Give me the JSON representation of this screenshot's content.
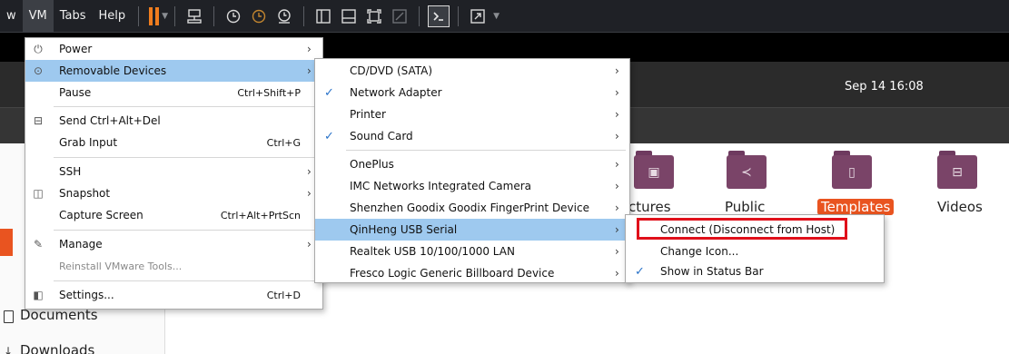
{
  "toolbar": {
    "menus": [
      "w",
      "VM",
      "Tabs",
      "Help"
    ],
    "active_menu": "VM"
  },
  "guest": {
    "clock": "Sep 14 16:08",
    "sidebar": {
      "documents": "Documents",
      "downloads": "Downloads"
    },
    "folders": [
      {
        "label": "ctures",
        "icon": "pictures-icon"
      },
      {
        "label": "Public",
        "icon": "share-icon"
      },
      {
        "label": "Templates",
        "icon": "templates-icon"
      },
      {
        "label": "Videos",
        "icon": "video-icon"
      }
    ]
  },
  "vm_menu": {
    "items": [
      {
        "label": "Power",
        "submenu": true,
        "icon": "power-icon"
      },
      {
        "label": "Removable Devices",
        "submenu": true,
        "icon": "usb-device-icon",
        "highlighted": true
      },
      {
        "label": "Pause",
        "shortcut": "Ctrl+Shift+P"
      },
      {
        "label": "Send Ctrl+Alt+Del",
        "icon": "keyboard-network-icon"
      },
      {
        "label": "Grab Input",
        "shortcut": "Ctrl+G"
      },
      {
        "label": "SSH",
        "submenu": true
      },
      {
        "label": "Snapshot",
        "submenu": true,
        "icon": "snapshot-icon"
      },
      {
        "label": "Capture Screen",
        "shortcut": "Ctrl+Alt+PrtScn"
      },
      {
        "label": "Manage",
        "submenu": true,
        "icon": "wrench-icon"
      },
      {
        "label": "Reinstall VMware Tools...",
        "disabled": true
      },
      {
        "label": "Settings...",
        "shortcut": "Ctrl+D",
        "icon": "settings-icon"
      }
    ]
  },
  "removable_menu": {
    "items": [
      {
        "label": "CD/DVD (SATA)",
        "checked": false
      },
      {
        "label": "Network Adapter",
        "checked": true
      },
      {
        "label": "Printer",
        "checked": false
      },
      {
        "label": "Sound Card",
        "checked": true
      },
      {
        "label": "OnePlus",
        "checked": false
      },
      {
        "label": "IMC Networks Integrated Camera",
        "checked": false
      },
      {
        "label": "Shenzhen Goodix Goodix FingerPrint Device",
        "checked": false
      },
      {
        "label": "QinHeng USB Serial",
        "checked": false,
        "highlighted": true
      },
      {
        "label": "Realtek USB 10/100/1000 LAN",
        "checked": false
      },
      {
        "label": "Fresco Logic Generic Billboard Device",
        "checked": false
      }
    ]
  },
  "usb_menu": {
    "items": [
      {
        "label": "Connect (Disconnect from Host)",
        "emphasized": true
      },
      {
        "label": "Change Icon..."
      },
      {
        "label": "Show in Status Bar",
        "checked": true
      }
    ]
  },
  "colors": {
    "toolbar_bg": "#1f2126",
    "pause_accent": "#f07d1e",
    "menu_highlight": "#9ec9ef",
    "check_mark": "#2a73c9",
    "emphasis_box": "#e0101a",
    "ubuntu_orange": "#e95420",
    "folder": "#7a4468"
  }
}
